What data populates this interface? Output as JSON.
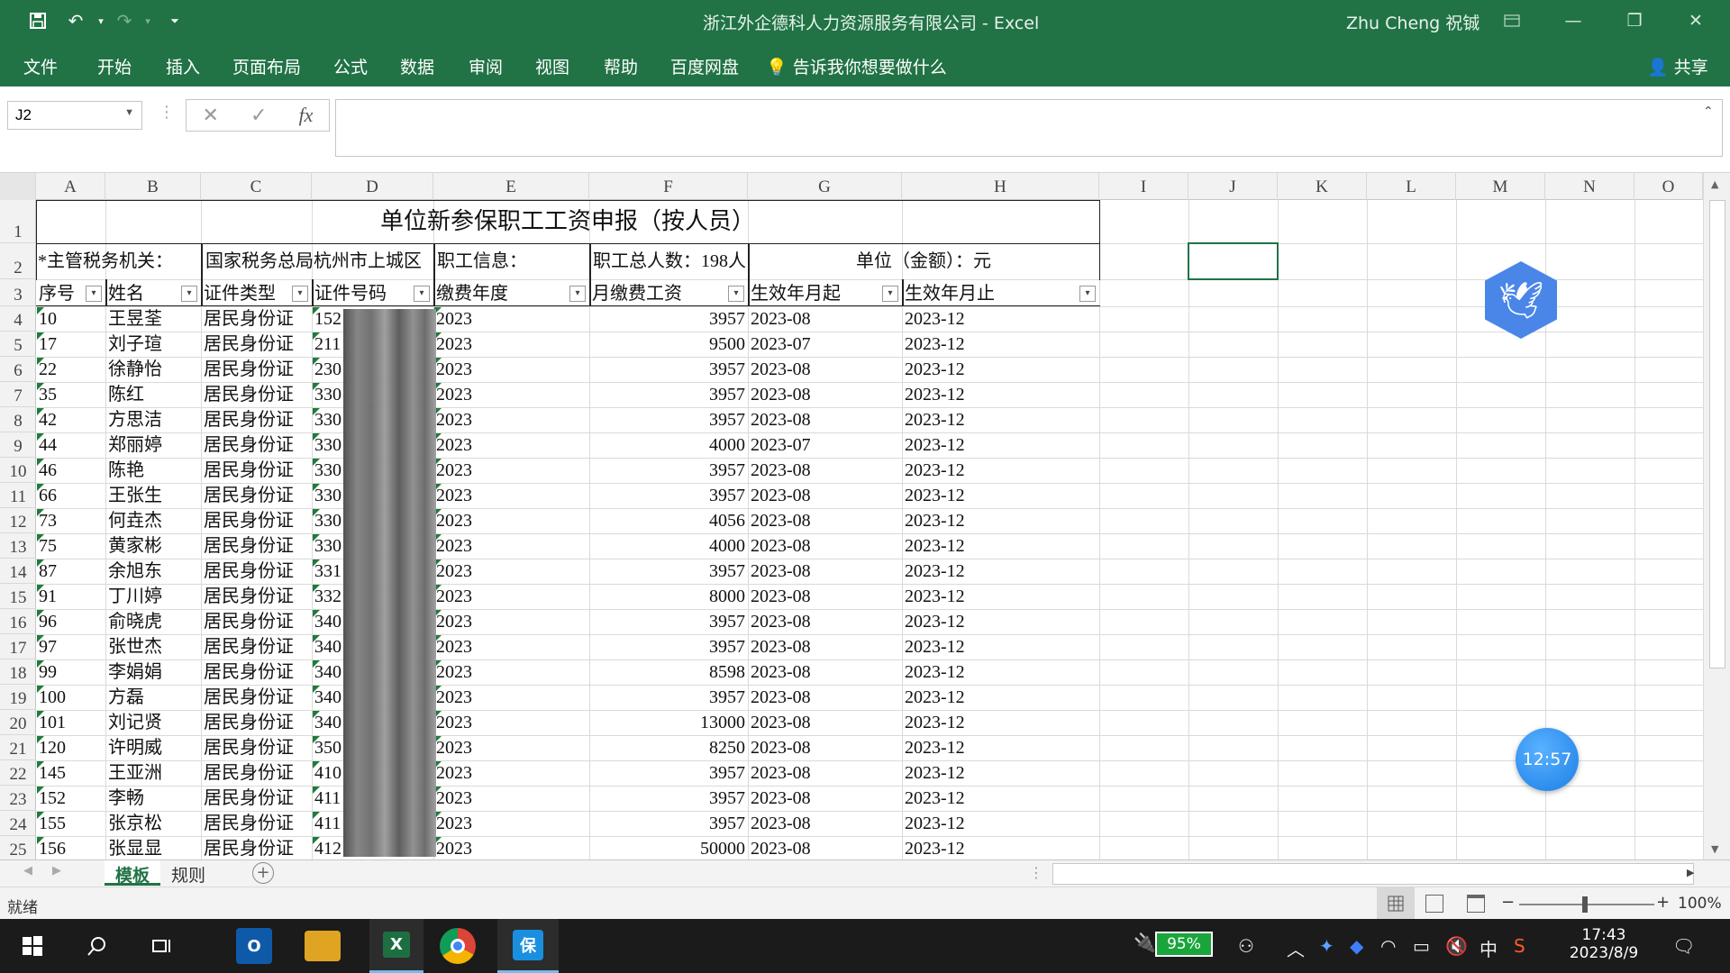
{
  "window": {
    "title": "浙江外企德科人力资源服务有限公司 - Excel",
    "user": "Zhu Cheng 祝铖"
  },
  "ribbon": {
    "menus": [
      "文件",
      "开始",
      "插入",
      "页面布局",
      "公式",
      "数据",
      "审阅",
      "视图",
      "帮助",
      "百度网盘"
    ],
    "tell_me": "告诉我你想要做什么",
    "share": "共享"
  },
  "formula_bar": {
    "name_box": "J2",
    "fx": "fx",
    "value": ""
  },
  "columns": [
    "A",
    "B",
    "C",
    "D",
    "E",
    "F",
    "G",
    "H",
    "I",
    "J",
    "K",
    "L",
    "M",
    "N",
    "O"
  ],
  "sheet": {
    "title": "单位新参保职工工资申报（按人员）",
    "row2": {
      "a": "*主管税务机关：",
      "c": "国家税务总局杭州市上城区",
      "e": "职工信息：",
      "f": "职工总人数：198人",
      "g": "单位（金额）：元"
    },
    "headers": [
      "序号",
      "姓名",
      "证件类型",
      "证件号码",
      "缴费年度",
      "月缴费工资",
      "生效年月起",
      "生效年月止"
    ],
    "rows": [
      {
        "no": "10",
        "name": "王昱荃",
        "type": "居民身份证",
        "id": "152",
        "year": "2023",
        "wage": "3957",
        "start": "2023-08",
        "end": "2023-12"
      },
      {
        "no": "17",
        "name": "刘子瑄",
        "type": "居民身份证",
        "id": "211",
        "year": "2023",
        "wage": "9500",
        "start": "2023-07",
        "end": "2023-12"
      },
      {
        "no": "22",
        "name": "徐静怡",
        "type": "居民身份证",
        "id": "230",
        "year": "2023",
        "wage": "3957",
        "start": "2023-08",
        "end": "2023-12"
      },
      {
        "no": "35",
        "name": "陈红",
        "type": "居民身份证",
        "id": "330",
        "year": "2023",
        "wage": "3957",
        "start": "2023-08",
        "end": "2023-12"
      },
      {
        "no": "42",
        "name": "方思洁",
        "type": "居民身份证",
        "id": "330",
        "year": "2023",
        "wage": "3957",
        "start": "2023-08",
        "end": "2023-12"
      },
      {
        "no": "44",
        "name": "郑丽婷",
        "type": "居民身份证",
        "id": "330",
        "year": "2023",
        "wage": "4000",
        "start": "2023-07",
        "end": "2023-12"
      },
      {
        "no": "46",
        "name": "陈艳",
        "type": "居民身份证",
        "id": "330",
        "year": "2023",
        "wage": "3957",
        "start": "2023-08",
        "end": "2023-12"
      },
      {
        "no": "66",
        "name": "王张生",
        "type": "居民身份证",
        "id": "330",
        "year": "2023",
        "wage": "3957",
        "start": "2023-08",
        "end": "2023-12"
      },
      {
        "no": "73",
        "name": "何垚杰",
        "type": "居民身份证",
        "id": "330",
        "year": "2023",
        "wage": "4056",
        "start": "2023-08",
        "end": "2023-12"
      },
      {
        "no": "75",
        "name": "黄家彬",
        "type": "居民身份证",
        "id": "330",
        "year": "2023",
        "wage": "4000",
        "start": "2023-08",
        "end": "2023-12"
      },
      {
        "no": "87",
        "name": "余旭东",
        "type": "居民身份证",
        "id": "331",
        "year": "2023",
        "wage": "3957",
        "start": "2023-08",
        "end": "2023-12"
      },
      {
        "no": "91",
        "name": "丁川婷",
        "type": "居民身份证",
        "id": "332",
        "year": "2023",
        "wage": "8000",
        "start": "2023-08",
        "end": "2023-12"
      },
      {
        "no": "96",
        "name": "俞晓虎",
        "type": "居民身份证",
        "id": "340",
        "year": "2023",
        "wage": "3957",
        "start": "2023-08",
        "end": "2023-12"
      },
      {
        "no": "97",
        "name": "张世杰",
        "type": "居民身份证",
        "id": "340",
        "year": "2023",
        "wage": "3957",
        "start": "2023-08",
        "end": "2023-12"
      },
      {
        "no": "99",
        "name": "李娟娟",
        "type": "居民身份证",
        "id": "340",
        "year": "2023",
        "wage": "8598",
        "start": "2023-08",
        "end": "2023-12"
      },
      {
        "no": "100",
        "name": "方磊",
        "type": "居民身份证",
        "id": "340",
        "year": "2023",
        "wage": "3957",
        "start": "2023-08",
        "end": "2023-12"
      },
      {
        "no": "101",
        "name": "刘记贤",
        "type": "居民身份证",
        "id": "340",
        "year": "2023",
        "wage": "13000",
        "start": "2023-08",
        "end": "2023-12"
      },
      {
        "no": "120",
        "name": "许明威",
        "type": "居民身份证",
        "id": "350",
        "year": "2023",
        "wage": "8250",
        "start": "2023-08",
        "end": "2023-12"
      },
      {
        "no": "145",
        "name": "王亚洲",
        "type": "居民身份证",
        "id": "410",
        "year": "2023",
        "wage": "3957",
        "start": "2023-08",
        "end": "2023-12"
      },
      {
        "no": "152",
        "name": "李畅",
        "type": "居民身份证",
        "id": "411",
        "year": "2023",
        "wage": "3957",
        "start": "2023-08",
        "end": "2023-12"
      },
      {
        "no": "155",
        "name": "张京松",
        "type": "居民身份证",
        "id": "411",
        "year": "2023",
        "wage": "3957",
        "start": "2023-08",
        "end": "2023-12"
      },
      {
        "no": "156",
        "name": "张显显",
        "type": "居民身份证",
        "id": "412",
        "year": "2023",
        "wage": "50000",
        "start": "2023-08",
        "end": "2023-12"
      }
    ]
  },
  "tabs": [
    "模板",
    "规则"
  ],
  "status": {
    "ready": "就绪",
    "zoom": "100%"
  },
  "overlay": {
    "timer": "12:57"
  },
  "taskbar": {
    "battery": "95%",
    "ime": "中",
    "time": "17:43",
    "date": "2023/8/9"
  },
  "colors": {
    "excel_green": "#217346",
    "taskbar": "#1b1b1b"
  }
}
